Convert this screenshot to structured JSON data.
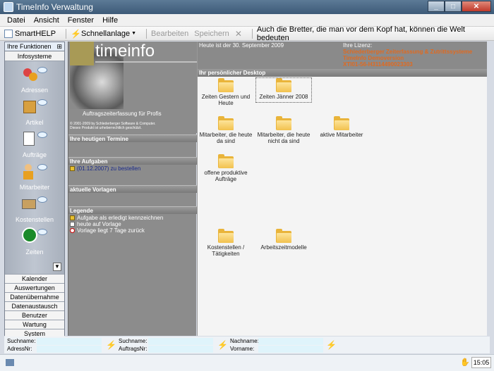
{
  "window": {
    "title": "TimeInfo Verwaltung",
    "buttons": [
      "_",
      "□",
      "✕"
    ]
  },
  "menu": [
    "Datei",
    "Ansicht",
    "Fenster",
    "Hilfe"
  ],
  "toolbar": {
    "smarthelp": "SmartHELP",
    "schnellanlage": "Schnellanlage",
    "bearbeiten": "Bearbeiten",
    "speichern": "Speichern",
    "quote": "Auch die Bretter, die man vor dem Kopf hat, können die Welt bedeuten"
  },
  "sidebar": {
    "header": "Ihre Funktionen",
    "section": "Infosysteme",
    "icons": [
      {
        "label": "Adressen",
        "icon": "addresses-icon"
      },
      {
        "label": "Artikel",
        "icon": "articles-icon"
      },
      {
        "label": "Aufträge",
        "icon": "orders-icon"
      },
      {
        "label": "Mitarbeiter",
        "icon": "employees-icon"
      },
      {
        "label": "Kostenstellen",
        "icon": "cost-centers-icon"
      },
      {
        "label": "Zeiten",
        "icon": "times-icon"
      }
    ],
    "categories": [
      "Kalender",
      "Auswertungen",
      "Datenübernahme",
      "Datenaustausch",
      "Benutzer",
      "Wartung",
      "System"
    ]
  },
  "info": {
    "logo_text": "timeinfo",
    "logo_sub": "Auftragszeiterfassung für Profis",
    "copyright": "© 2001-2009 by Schlederberger Software & Computer.",
    "copyright2": "Dieses Produkt ist urheberrechtlich geschützt.",
    "termine_heading": "Ihre heutigen Termine",
    "aufgaben_heading": "Ihre Aufgaben",
    "aufgabe_item": "(01.12.2007) zu bestellen",
    "vorlagen_heading": "aktuelle Vorlagen",
    "legende_heading": "Legende",
    "legend": [
      "Aufgabe als erledigt kennzeichnen",
      "heute auf Vorlage",
      "Vorlage liegt 7 Tage zurück"
    ]
  },
  "desktop": {
    "date_text": "Heute ist der 30. September 2009",
    "license_label": "Ihre Lizenz:",
    "license_lines": [
      "Schlederberger Zeiterfassung & Zutrittssysteme",
      "TimeInfo Demoversion",
      "XTI01-56-H3114490023303"
    ],
    "heading": "Ihr persönlicher Desktop",
    "folders": [
      {
        "label": "Zeiten Gestern und Heute"
      },
      {
        "label": "Zeiten Jänner 2008"
      },
      {
        "label": "Mitarbeiter, die heute da sind"
      },
      {
        "label": "Mitarbeiter, die heute nicht da sind"
      },
      {
        "label": "aktive Mitarbeiter"
      },
      {
        "label": "offene produktive Aufträge"
      },
      {
        "label": "Kostenstellen / Tätigkeiten"
      },
      {
        "label": "Arbeitszeitmodelle"
      }
    ]
  },
  "status": {
    "suchname1": "Suchname:",
    "adressnr": "AdressNr:",
    "suchname2": "Suchname:",
    "auftragsnr": "AuftragsNr:",
    "nachname": "Nachname:",
    "vorname": "Vorname:"
  },
  "clock": "15:05"
}
